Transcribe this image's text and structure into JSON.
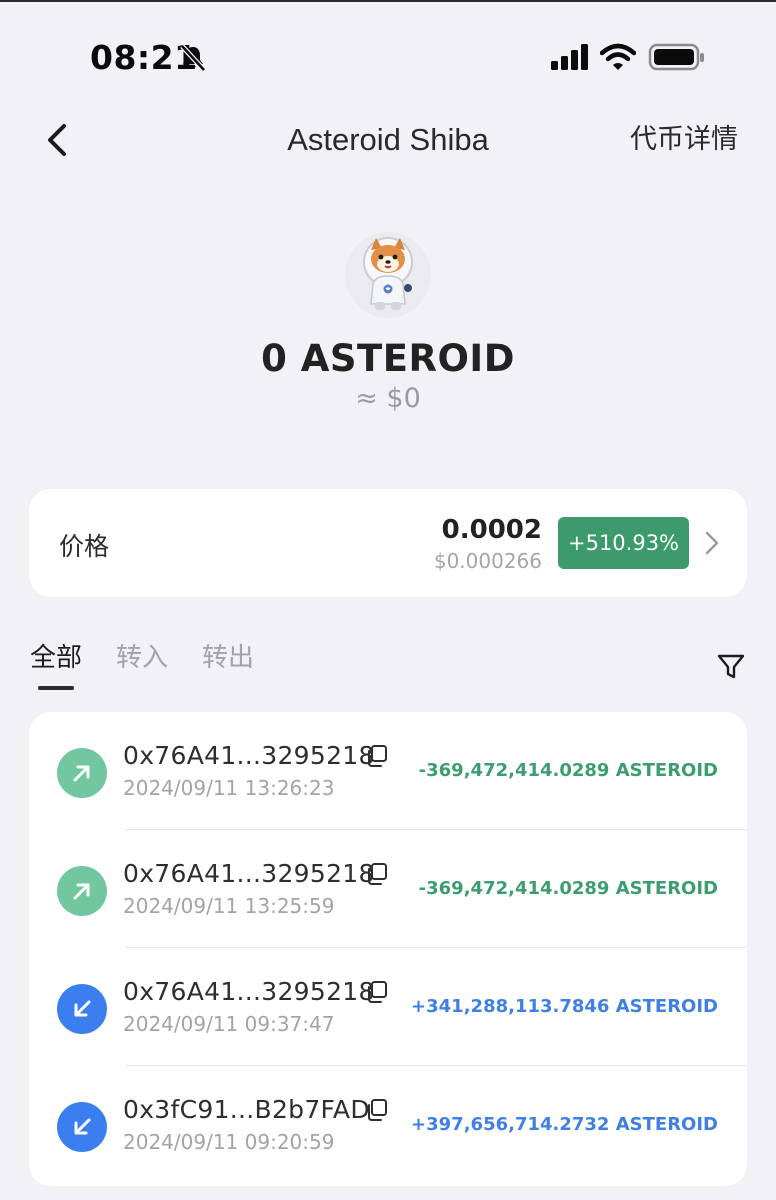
{
  "status_bar": {
    "time": "08:21"
  },
  "nav": {
    "title": "Asteroid Shiba",
    "right_label": "代币详情"
  },
  "token": {
    "balance": "0 ASTEROID",
    "fiat_value": "≈ $0"
  },
  "price_card": {
    "label": "价格",
    "value": "0.0002",
    "usd_value": "$0.000266",
    "change": "+510.93%",
    "change_color": "#3d9a6c"
  },
  "tabs": [
    {
      "label": "全部",
      "active": true
    },
    {
      "label": "转入",
      "active": false
    },
    {
      "label": "转出",
      "active": false
    }
  ],
  "transactions": [
    {
      "direction": "out",
      "address": "0x76A41...3295218",
      "time": "2024/09/11 13:26:23",
      "amount": "-369,472,414.0289 ASTEROID"
    },
    {
      "direction": "out",
      "address": "0x76A41...3295218",
      "time": "2024/09/11 13:25:59",
      "amount": "-369,472,414.0289 ASTEROID"
    },
    {
      "direction": "in",
      "address": "0x76A41...3295218",
      "time": "2024/09/11 09:37:47",
      "amount": "+341,288,113.7846 ASTEROID"
    },
    {
      "direction": "in",
      "address": "0x3fC91...B2b7FAD",
      "time": "2024/09/11 09:20:59",
      "amount": "+397,656,714.2732 ASTEROID"
    }
  ],
  "colors": {
    "outgoing": "#3c9d6f",
    "incoming": "#3f7fe6",
    "outgoing_icon_bg": "#72c7a1",
    "incoming_icon_bg": "#3b7ef0"
  },
  "icons": {
    "back": "chevron-left-icon",
    "filter": "filter-icon",
    "copy": "copy-icon",
    "sent": "arrow-up-right-icon",
    "received": "arrow-down-left-icon"
  }
}
